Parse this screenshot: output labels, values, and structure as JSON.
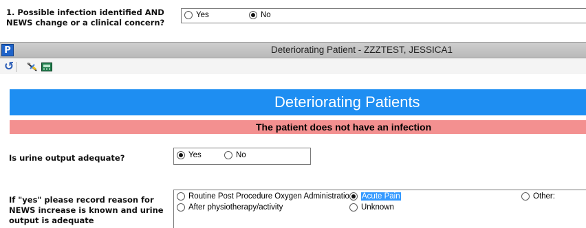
{
  "q1": {
    "label_line1": "1. Possible infection identified AND",
    "label_line2": "NEWS change or a clinical concern?",
    "options": [
      {
        "label": "Yes",
        "checked": false
      },
      {
        "label": "No",
        "checked": true
      }
    ]
  },
  "window": {
    "app_icon_letter": "P",
    "title": "Deteriorating Patient - ZZZTEST, JESSICA1"
  },
  "toolbar": {
    "icons": [
      "refresh-icon",
      "tools-icon",
      "calculator-icon"
    ],
    "refresh_glyph": "↺"
  },
  "form": {
    "banner_title": "Deteriorating Patients",
    "alert_text": "The patient does not have an infection",
    "urine": {
      "label": "Is urine output adequate?",
      "options": [
        {
          "label": "Yes",
          "checked": true
        },
        {
          "label": "No",
          "checked": false
        }
      ]
    },
    "reason": {
      "label_line1": "If \"yes\" please record reason for",
      "label_line2": "NEWS increase is known and urine",
      "label_line3": "output is adequate",
      "options": [
        {
          "label": "Routine Post Procedure Oxygen Administration",
          "checked": false
        },
        {
          "label": "Acute Pain",
          "checked": true,
          "highlighted": true
        },
        {
          "label": "Other:",
          "checked": false
        },
        {
          "label": "After physiotherapy/activity",
          "checked": false
        },
        {
          "label": "Unknown",
          "checked": false
        }
      ]
    }
  },
  "colors": {
    "banner": "#1e8ef2",
    "alert": "#f39090",
    "selection_highlight": "#3399ff",
    "titlebar": "#c4c4c4"
  }
}
